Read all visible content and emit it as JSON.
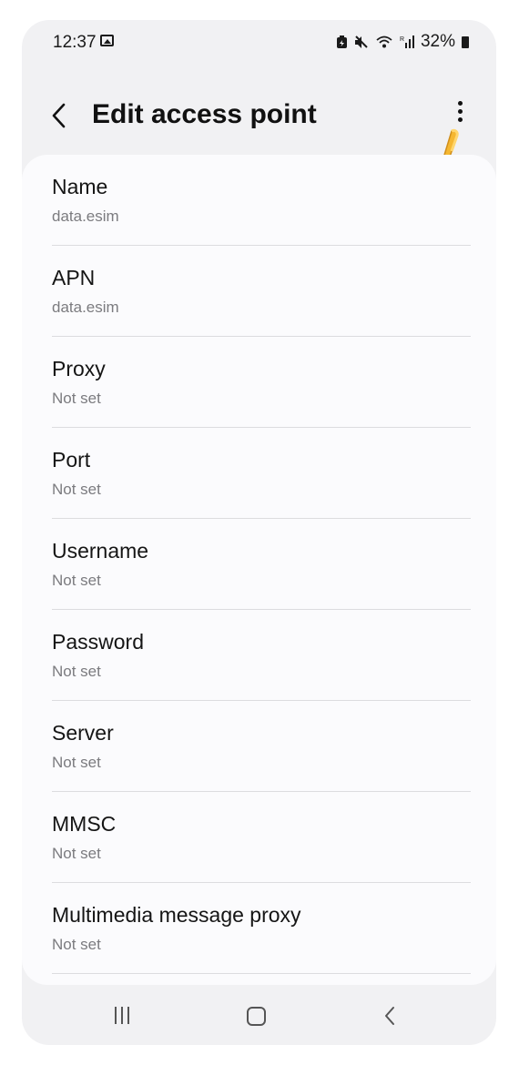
{
  "status_bar": {
    "time": "12:37",
    "battery": "32%",
    "icons": [
      "image-icon",
      "battery-saver-icon",
      "mute-icon",
      "wifi-icon",
      "signal-icon"
    ]
  },
  "header": {
    "title": "Edit access point",
    "back_icon": "chevron-left-icon",
    "more_icon": "more-vertical-icon"
  },
  "settings": [
    {
      "label": "Name",
      "value": "data.esim"
    },
    {
      "label": "APN",
      "value": "data.esim"
    },
    {
      "label": "Proxy",
      "value": "Not set"
    },
    {
      "label": "Port",
      "value": "Not set"
    },
    {
      "label": "Username",
      "value": "Not set"
    },
    {
      "label": "Password",
      "value": "Not set"
    },
    {
      "label": "Server",
      "value": "Not set"
    },
    {
      "label": "MMSC",
      "value": "Not set"
    },
    {
      "label": "Multimedia message proxy",
      "value": "Not set"
    }
  ],
  "navbar": {
    "icons": [
      "recents-icon",
      "home-icon",
      "back-icon"
    ]
  },
  "colors": {
    "background": "#f1f1f3",
    "card": "#fbfbfd",
    "divider": "#dcdcdf",
    "secondary_text": "#7b7b7f"
  }
}
